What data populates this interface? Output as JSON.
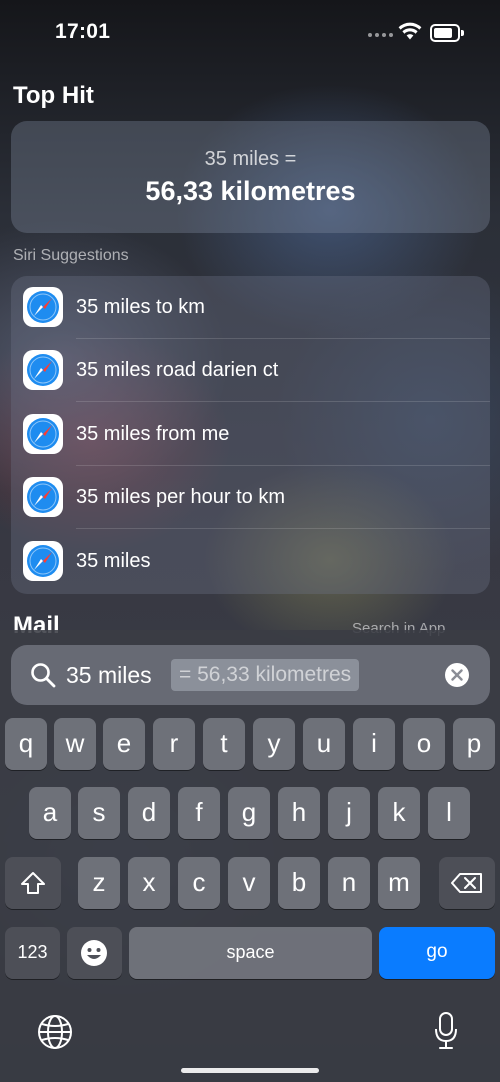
{
  "status_bar": {
    "time": "17:01"
  },
  "top_hit": {
    "title": "Top Hit",
    "equation": "35 miles =",
    "result": "56,33 kilometres"
  },
  "siri_suggestions": {
    "label": "Siri Suggestions",
    "items": [
      {
        "label": "35 miles to km",
        "icon": "safari-icon"
      },
      {
        "label": "35 miles road darien ct",
        "icon": "safari-icon"
      },
      {
        "label": "35 miles from me",
        "icon": "safari-icon"
      },
      {
        "label": "35 miles per hour to km",
        "icon": "safari-icon"
      },
      {
        "label": "35 miles",
        "icon": "safari-icon"
      }
    ]
  },
  "mail": {
    "title": "Mail",
    "search_in_app": "Search in App"
  },
  "search": {
    "query": "35 miles",
    "suggestion": "=  56,33 kilometres"
  },
  "keyboard": {
    "row1": [
      "q",
      "w",
      "e",
      "r",
      "t",
      "y",
      "u",
      "i",
      "o",
      "p"
    ],
    "row2": [
      "a",
      "s",
      "d",
      "f",
      "g",
      "h",
      "j",
      "k",
      "l"
    ],
    "row3": [
      "z",
      "x",
      "c",
      "v",
      "b",
      "n",
      "m"
    ],
    "numbers_label": "123",
    "space_label": "space",
    "go_label": "go"
  },
  "colors": {
    "go_key": "#0a7cff"
  }
}
